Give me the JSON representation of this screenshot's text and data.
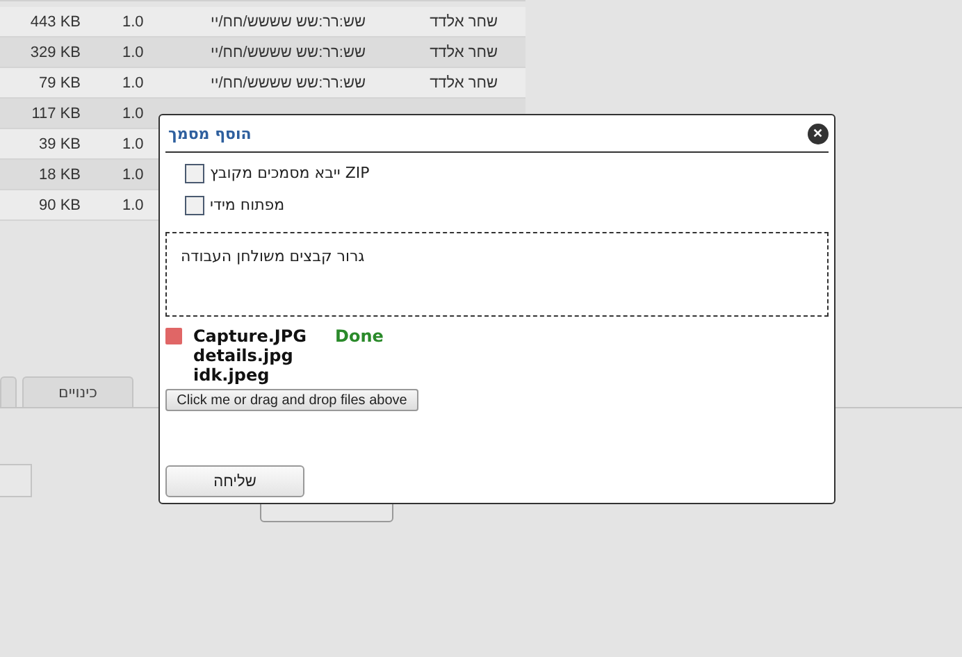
{
  "table": {
    "rows": [
      {
        "size": "443 KB",
        "version": "1.0",
        "date": "שש:רר:שש שששש/חח/יי",
        "author": "שחר אלדד"
      },
      {
        "size": "329 KB",
        "version": "1.0",
        "date": "שש:רר:שש שששש/חח/יי",
        "author": "שחר אלדד"
      },
      {
        "size": "79 KB",
        "version": "1.0",
        "date": "שש:רר:שש שששש/חח/יי",
        "author": "שחר אלדד"
      },
      {
        "size": "117 KB",
        "version": "1.0"
      },
      {
        "size": "39 KB",
        "version": "1.0"
      },
      {
        "size": "18 KB",
        "version": "1.0"
      },
      {
        "size": "90 KB",
        "version": "1.0"
      }
    ]
  },
  "tabs": [
    {
      "selected": false
    },
    {
      "label": "כינויים",
      "selected": false
    }
  ],
  "dialog": {
    "title": "הוסף מסמך",
    "close": "✕",
    "options": [
      {
        "label": "ייבא מסמכים מקובץ ZIP",
        "checked": false
      },
      {
        "label": "מפתוח מידי",
        "checked": false
      }
    ],
    "drop_zone": "גרור קבצים משולחן העבודה",
    "files": [
      {
        "name": "Capture.JPG",
        "status": "Done",
        "removable": true
      },
      {
        "name": "details.jpg"
      },
      {
        "name": "idk.jpeg"
      }
    ],
    "upload_button": "Click me or drag and drop files above",
    "submit_button": "שליחה"
  }
}
